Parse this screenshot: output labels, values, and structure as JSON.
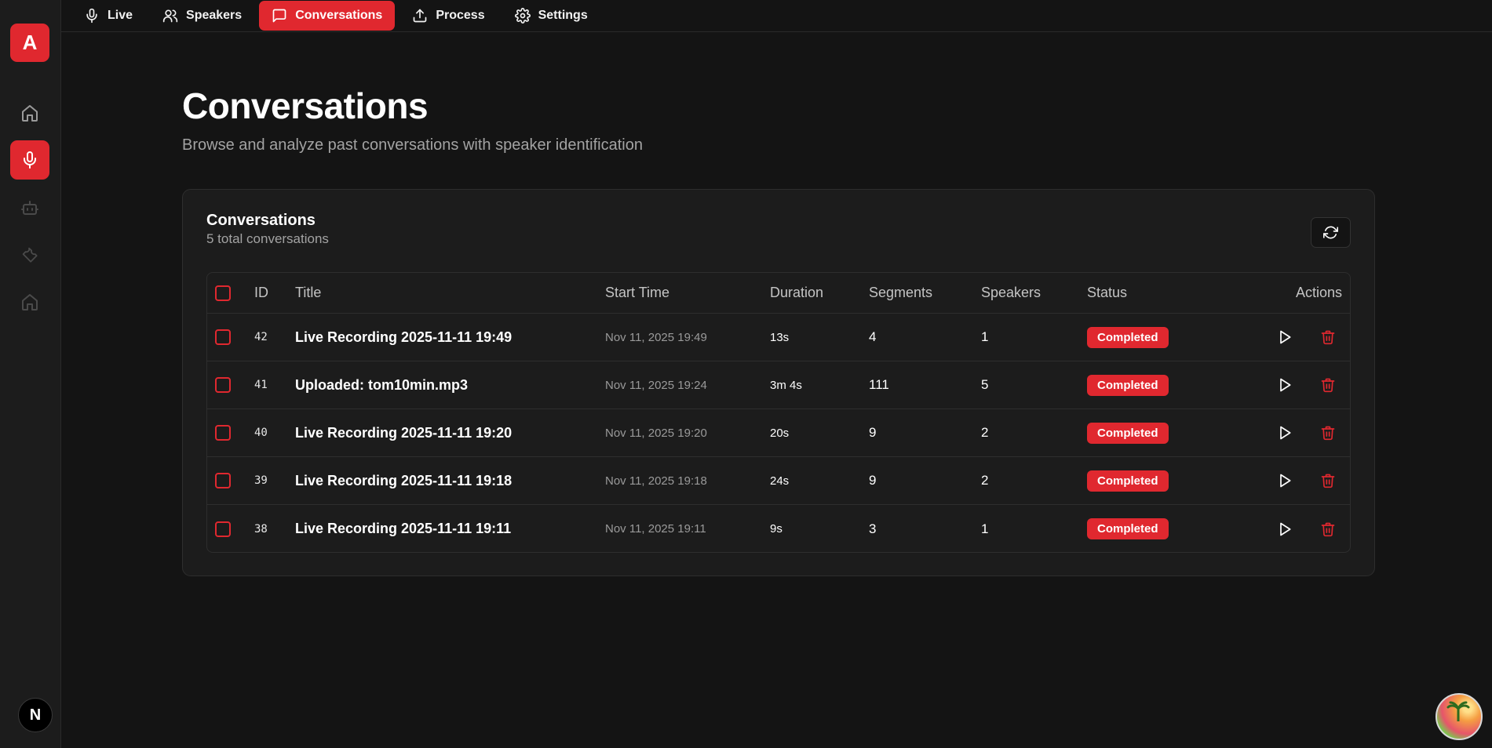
{
  "sidebar": {
    "logo_letter": "A",
    "bottom_badge": "N"
  },
  "topnav": {
    "tabs": [
      {
        "label": "Live",
        "icon": "mic-icon"
      },
      {
        "label": "Speakers",
        "icon": "users-icon"
      },
      {
        "label": "Conversations",
        "icon": "message-square-icon",
        "active": true
      },
      {
        "label": "Process",
        "icon": "upload-icon"
      },
      {
        "label": "Settings",
        "icon": "gear-icon"
      }
    ]
  },
  "header": {
    "title": "Conversations",
    "subtitle": "Browse and analyze past conversations with speaker identification"
  },
  "card": {
    "title": "Conversations",
    "subtitle": "5 total conversations"
  },
  "table": {
    "columns": {
      "id": "ID",
      "title": "Title",
      "start": "Start Time",
      "duration": "Duration",
      "segments": "Segments",
      "speakers": "Speakers",
      "status": "Status",
      "actions": "Actions"
    },
    "rows": [
      {
        "id": "42",
        "title": "Live Recording 2025-11-11 19:49",
        "start": "Nov 11, 2025 19:49",
        "duration": "13s",
        "segments": "4",
        "speakers": "1",
        "status": "Completed"
      },
      {
        "id": "41",
        "title": "Uploaded: tom10min.mp3",
        "start": "Nov 11, 2025 19:24",
        "duration": "3m 4s",
        "segments": "111",
        "speakers": "5",
        "status": "Completed"
      },
      {
        "id": "40",
        "title": "Live Recording 2025-11-11 19:20",
        "start": "Nov 11, 2025 19:20",
        "duration": "20s",
        "segments": "9",
        "speakers": "2",
        "status": "Completed"
      },
      {
        "id": "39",
        "title": "Live Recording 2025-11-11 19:18",
        "start": "Nov 11, 2025 19:18",
        "duration": "24s",
        "segments": "9",
        "speakers": "2",
        "status": "Completed"
      },
      {
        "id": "38",
        "title": "Live Recording 2025-11-11 19:11",
        "start": "Nov 11, 2025 19:11",
        "duration": "9s",
        "segments": "3",
        "speakers": "1",
        "status": "Completed"
      }
    ]
  },
  "colors": {
    "accent": "#e0282f",
    "background": "#141414",
    "card": "#1c1c1c"
  }
}
